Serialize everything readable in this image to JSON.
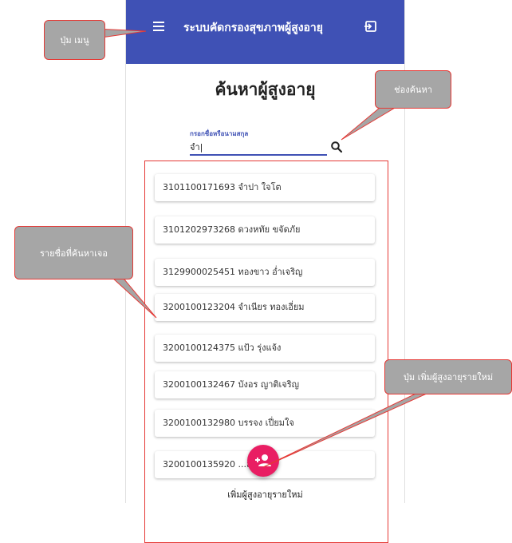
{
  "appbar": {
    "title": "ระบบคัดกรองสุขภาพผู้สูงอายุ",
    "color": "#3f51b5",
    "menu_icon": "menu-icon",
    "exit_icon": "exit-icon"
  },
  "page": {
    "title": "ค้นหาผู้สูงอายุ"
  },
  "search": {
    "label": "กรอกชื่อหรือนามสกุล",
    "value": "จำ|",
    "icon": "search-icon"
  },
  "results": [
    {
      "text": "3101100171693 จำปา ใจโต"
    },
    {
      "text": "3101202973268 ดวงหทัย ขจัดภัย"
    },
    {
      "text": "3129900025451 ทองขาว อ่ำเจริญ"
    },
    {
      "text": "3200100123204 จำเนียร ทองเอี่ยม"
    },
    {
      "text": "3200100124375 แป้ว รุ่งแจ้ง"
    },
    {
      "text": "3200100132467 บังอร ญาติเจริญ"
    },
    {
      "text": "3200100132980 บรรจง เปี่ยมใจ"
    },
    {
      "text": "3200100135920 ...ลาย"
    }
  ],
  "fab": {
    "label": "เพิ่มผู้สูงอายุรายใหม่",
    "color": "#e91e63",
    "icon": "add-person-icon"
  },
  "callouts": {
    "menu": "ปุ่ม เมนู",
    "search": "ช่องค้นหา",
    "results": "รายชื่อที่ค้นหาเจอ",
    "add": "ปุ่ม เพิ่มผู้สูงอายุรายใหม่"
  }
}
